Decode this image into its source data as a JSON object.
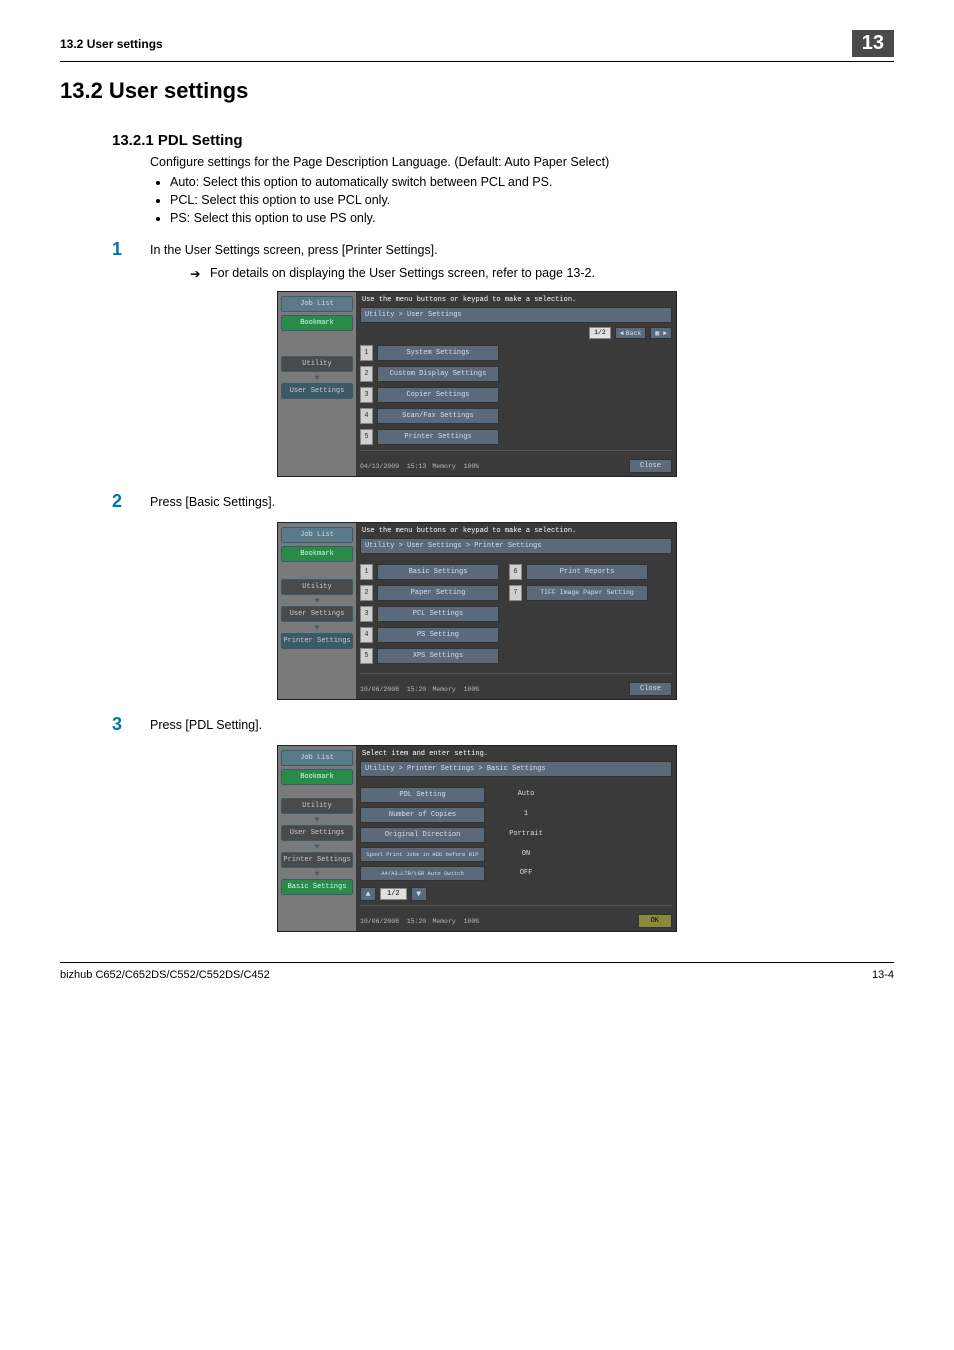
{
  "header": {
    "left": "13.2    User settings",
    "right": "13"
  },
  "h1": "13.2     User settings",
  "h2": "13.2.1   PDL Setting",
  "intro": "Configure settings for the Page Description Language. (Default: Auto Paper Select)",
  "bullets": [
    "Auto: Select this option to automatically switch between PCL and PS.",
    "PCL: Select this option to use PCL only.",
    "PS: Select this option to use PS only."
  ],
  "steps": {
    "s1": {
      "num": "1",
      "txt": "In the User Settings screen, press [Printer Settings]."
    },
    "s1sub": "For details on displaying the User Settings screen, refer to page 13-2.",
    "s2": {
      "num": "2",
      "txt": "Press [Basic Settings]."
    },
    "s3": {
      "num": "3",
      "txt": "Press [PDL Setting]."
    }
  },
  "shot1": {
    "prompt": "Use the menu buttons or keypad to make a selection.",
    "crumb": "Utility > User Settings",
    "page": "1/2",
    "back": "Back",
    "side": {
      "joblist": "Job List",
      "bookmark": "Bookmark",
      "utility": "Utility",
      "usersettings": "User Settings"
    },
    "items": [
      {
        "n": "1",
        "l": "System Settings"
      },
      {
        "n": "2",
        "l": "Custom Display Settings"
      },
      {
        "n": "3",
        "l": "Copier Settings"
      },
      {
        "n": "4",
        "l": "Scan/Fax Settings"
      },
      {
        "n": "5",
        "l": "Printer Settings"
      }
    ],
    "date": "04/13/2009",
    "time": "15:13",
    "mem": "Memory",
    "memv": "100%",
    "close": "Close"
  },
  "shot2": {
    "prompt": "Use the menu buttons or keypad to make a selection.",
    "crumb": "Utility > User Settings > Printer Settings",
    "side": {
      "joblist": "Job List",
      "bookmark": "Bookmark",
      "utility": "Utility",
      "usersettings": "User Settings",
      "printersettings": "Printer Settings"
    },
    "left": [
      {
        "n": "1",
        "l": "Basic Settings"
      },
      {
        "n": "2",
        "l": "Paper Setting"
      },
      {
        "n": "3",
        "l": "PCL Settings"
      },
      {
        "n": "4",
        "l": "PS Setting"
      },
      {
        "n": "5",
        "l": "XPS Settings"
      }
    ],
    "right": [
      {
        "n": "6",
        "l": "Print Reports"
      },
      {
        "n": "7",
        "l": "TIFF Image Paper Setting"
      }
    ],
    "date": "10/06/2008",
    "time": "15:20",
    "mem": "Memory",
    "memv": "100%",
    "close": "Close"
  },
  "shot3": {
    "prompt": "Select item and enter setting.",
    "crumb": "Utility > Printer Settings > Basic Settings",
    "side": {
      "joblist": "Job List",
      "bookmark": "Bookmark",
      "utility": "Utility",
      "usersettings": "User Settings",
      "printersettings": "Printer Settings",
      "basicsettings": "Basic Settings"
    },
    "settings": [
      {
        "l": "PDL Setting",
        "v": "Auto"
      },
      {
        "l": "Number of Copies",
        "v": "1"
      },
      {
        "l": "Original Direction",
        "v": "Portrait"
      },
      {
        "l": "Spool Print Jobs in HDD before RIP",
        "v": "ON"
      },
      {
        "l": "A4/A3↔LTR/LGR Auto Switch",
        "v": "OFF"
      }
    ],
    "page": "1/2",
    "date": "10/06/2008",
    "time": "15:20",
    "mem": "Memory",
    "memv": "100%",
    "ok": "OK"
  },
  "footer": {
    "left": "bizhub C652/C652DS/C552/C552DS/C452",
    "right": "13-4"
  }
}
